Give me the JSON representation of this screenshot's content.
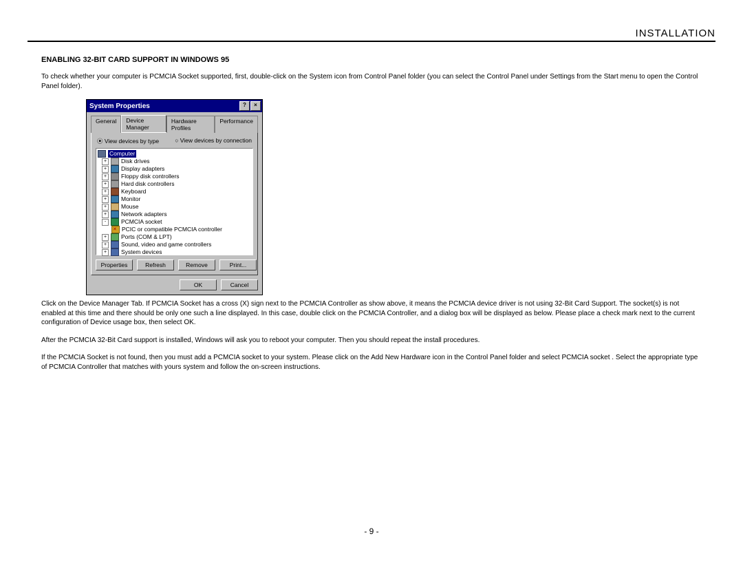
{
  "header": {
    "title": "INSTALLATION"
  },
  "heading": "ENABLING 32-BIT CARD SUPPORT IN WINDOWS 95",
  "para1": "To check whether your computer is PCMCIA Socket supported, first, double-click on the  System  icon from  Control Panel  folder (you can select the  Control Panel  under  Settings  from the  Start  menu to  open the  Control Panel  folder).",
  "para2": "Click on the Device Manager Tab. If  PCMCIA Socket  has a cross (X) sign next to the PCMCIA Controller as show above, it means the PCMCIA device driver is not using 32-Bit Card Support. The socket(s) is not enabled at this time and there should be only one such a line displayed. In this case, double click on the PCMCIA Controller, and a dialog box will be displayed as below. Please place a check mark next to the current configuration of Device usage box, then select OK.",
  "para3": "After the PCMCIA 32-Bit Card support is installed, Windows will ask you to reboot your computer. Then you should repeat the install procedures.",
  "para4": "If the PCMCIA Socket is not found, then you must add a PCMCIA socket to your system. Please click on the  Add New Hardware  icon in the Control Panel folder and select  PCMCIA socket .  Select the appropriate type of PCMCIA Controller that matches with yours system and follow the on-screen instructions.",
  "pagenum": "-  9  -",
  "win": {
    "title": "System Properties",
    "help_btn": "?",
    "close_btn": "×",
    "tabs": {
      "general": "General",
      "devmgr": "Device Manager",
      "hwprof": "Hardware Profiles",
      "perf": "Performance"
    },
    "radios": {
      "bytype": "View devices by type",
      "byconn": "View devices by connection"
    },
    "tree": {
      "computer": "Computer",
      "disk": "Disk drives",
      "display": "Display adapters",
      "floppy": "Floppy disk controllers",
      "hdd": "Hard disk controllers",
      "keyboard": "Keyboard",
      "monitor": "Monitor",
      "mouse": "Mouse",
      "net": "Network adapters",
      "pcmcia": "PCMCIA socket",
      "pcmcia_child": "PCIC or compatible PCMCIA controller",
      "ports": "Ports (COM & LPT)",
      "sound": "Sound, video and game controllers",
      "system": "System devices"
    },
    "buttons": {
      "properties": "Properties",
      "refresh": "Refresh",
      "remove": "Remove",
      "print": "Print...",
      "ok": "OK",
      "cancel": "Cancel"
    }
  }
}
